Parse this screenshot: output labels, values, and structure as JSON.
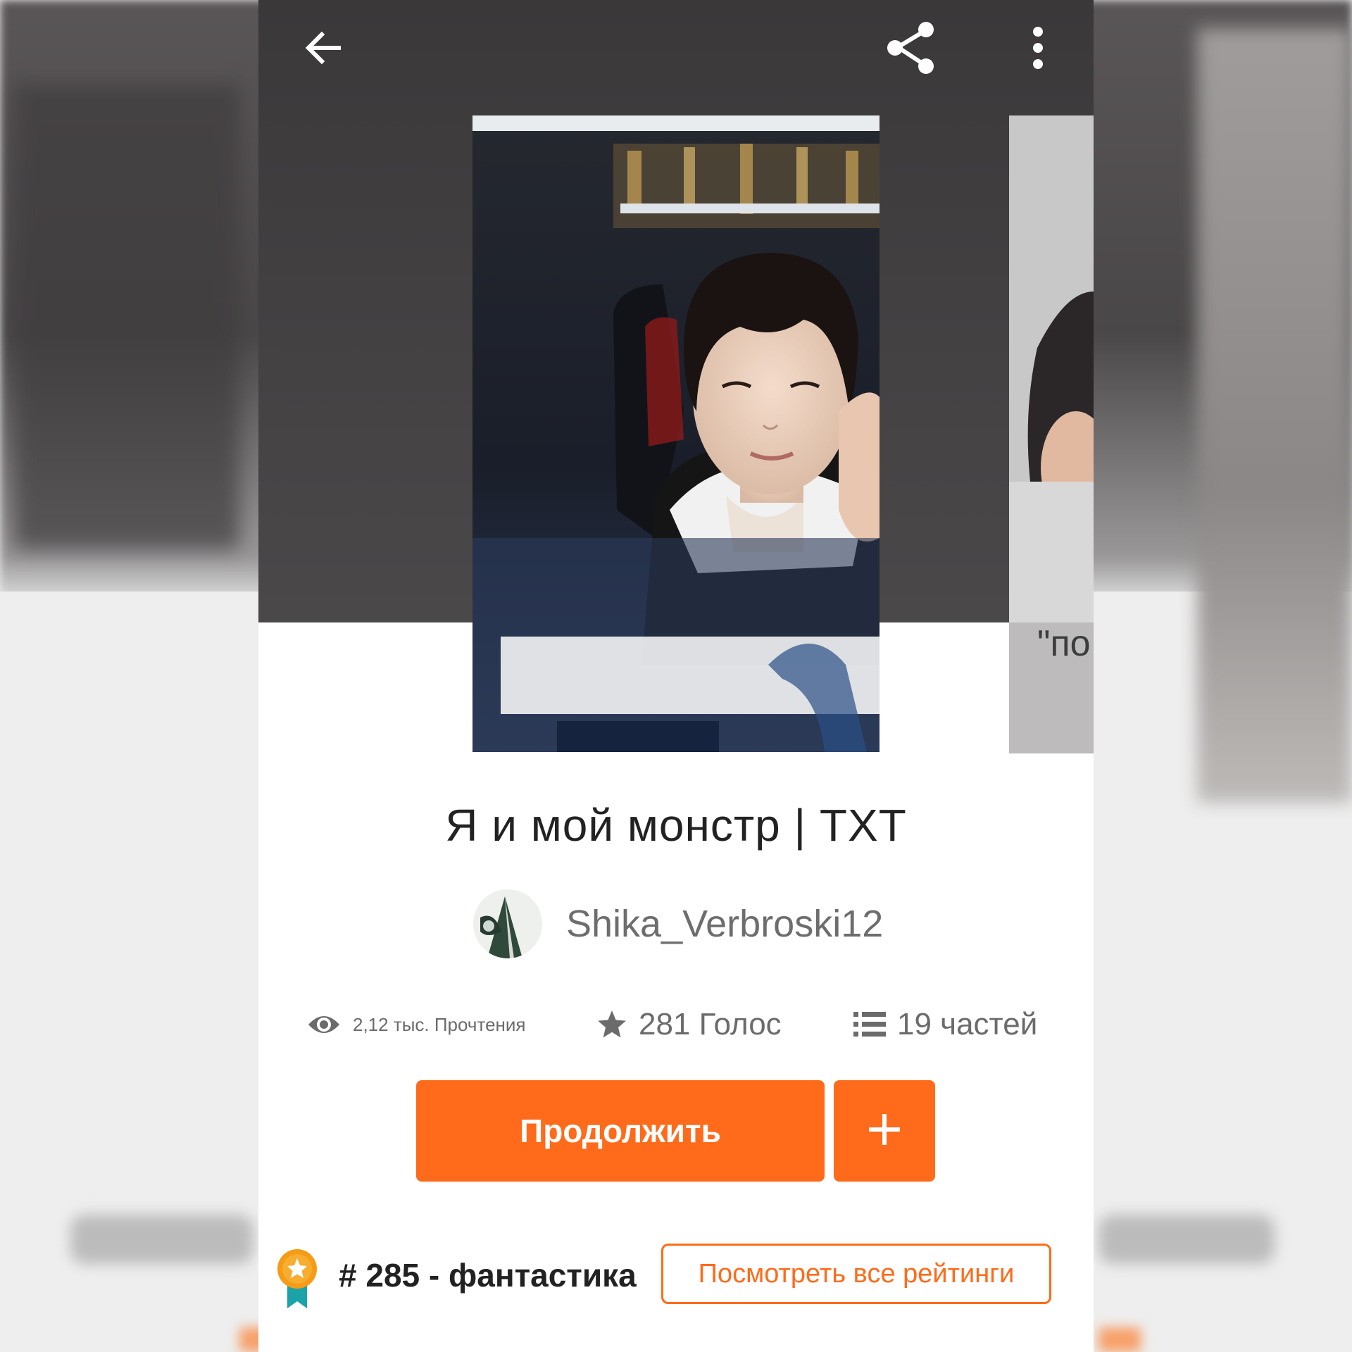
{
  "story": {
    "title": "Я и мой монстр | TXT",
    "author": "Shika_Verbroski12"
  },
  "next_cover": {
    "peek_text": "\"по"
  },
  "stats": {
    "reads": "2,12 тыс. Прочтения",
    "votes": "281 Голос",
    "parts": "19 частей"
  },
  "actions": {
    "continue_label": "Продолжить",
    "add_label": "+"
  },
  "ranking": {
    "text": "# 285 - фантастика",
    "view_all_label": "Посмотреть все рейтинги"
  },
  "icons": {
    "back": "arrow-left-icon",
    "share": "share-icon",
    "more": "more-vertical-icon",
    "reads": "eye-icon",
    "votes": "star-icon",
    "parts": "list-icon",
    "badge": "award-ribbon-icon"
  },
  "colors": {
    "accent": "#ff6b1a",
    "badge_gold": "#f59b16",
    "badge_ribbon": "#1aa3a8",
    "text_primary": "#222222",
    "text_secondary": "#6b6b6b"
  }
}
